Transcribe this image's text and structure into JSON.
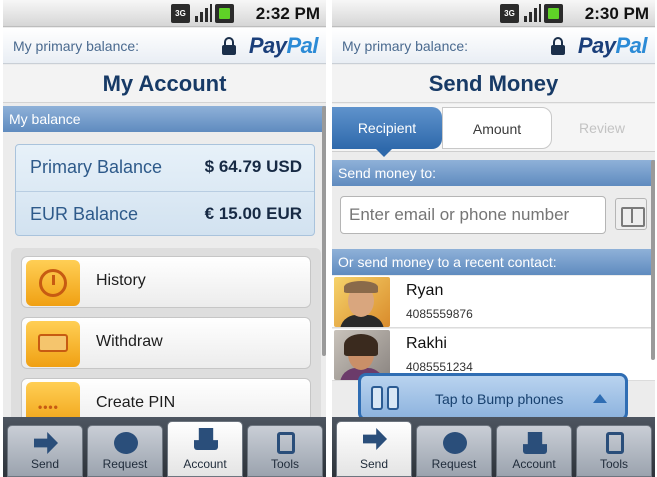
{
  "screens": {
    "left": {
      "status": {
        "network": "3G",
        "time": "2:32 PM"
      },
      "header": {
        "balance_label": "My primary balance:",
        "brand_pay": "Pay",
        "brand_pal": "Pal"
      },
      "title": "My Account",
      "section_balance": "My balance",
      "balances": [
        {
          "name": "Primary Balance",
          "value": "$ 64.79 USD"
        },
        {
          "name": "EUR Balance",
          "value": "€ 15.00 EUR"
        }
      ],
      "menu": [
        {
          "label": "History",
          "icon": "history-icon"
        },
        {
          "label": "Withdraw",
          "icon": "withdraw-icon"
        },
        {
          "label": "Create PIN",
          "icon": "pin-icon",
          "dots": "••••"
        }
      ],
      "tabs": [
        {
          "label": "Send",
          "icon": "send-icon"
        },
        {
          "label": "Request",
          "icon": "request-icon"
        },
        {
          "label": "Account",
          "icon": "account-icon",
          "active": true
        },
        {
          "label": "Tools",
          "icon": "tools-icon"
        }
      ]
    },
    "right": {
      "status": {
        "network": "3G",
        "time": "2:30 PM"
      },
      "header": {
        "balance_label": "My primary balance:",
        "brand_pay": "Pay",
        "brand_pal": "Pal"
      },
      "title": "Send Money",
      "steps": [
        "Recipient",
        "Amount",
        "Review"
      ],
      "section_send_to": "Send money to:",
      "email_placeholder": "Enter email or phone number",
      "section_recent": "Or send money to a recent contact:",
      "contacts": [
        {
          "name": "Ryan",
          "number": "4085559876"
        },
        {
          "name": "Rakhi",
          "number": "4085551234"
        }
      ],
      "bump_label": "Tap to Bump phones",
      "tabs": [
        {
          "label": "Send",
          "icon": "send-icon",
          "active": true
        },
        {
          "label": "Request",
          "icon": "request-icon"
        },
        {
          "label": "Account",
          "icon": "account-icon"
        },
        {
          "label": "Tools",
          "icon": "tools-icon"
        }
      ]
    }
  },
  "colors": {
    "brand_dark": "#1b3f7a",
    "brand_light": "#2c8bd6",
    "section_blue": "#5f8bbf",
    "title_navy": "#173a66",
    "accent_orange": "#f0a013"
  }
}
